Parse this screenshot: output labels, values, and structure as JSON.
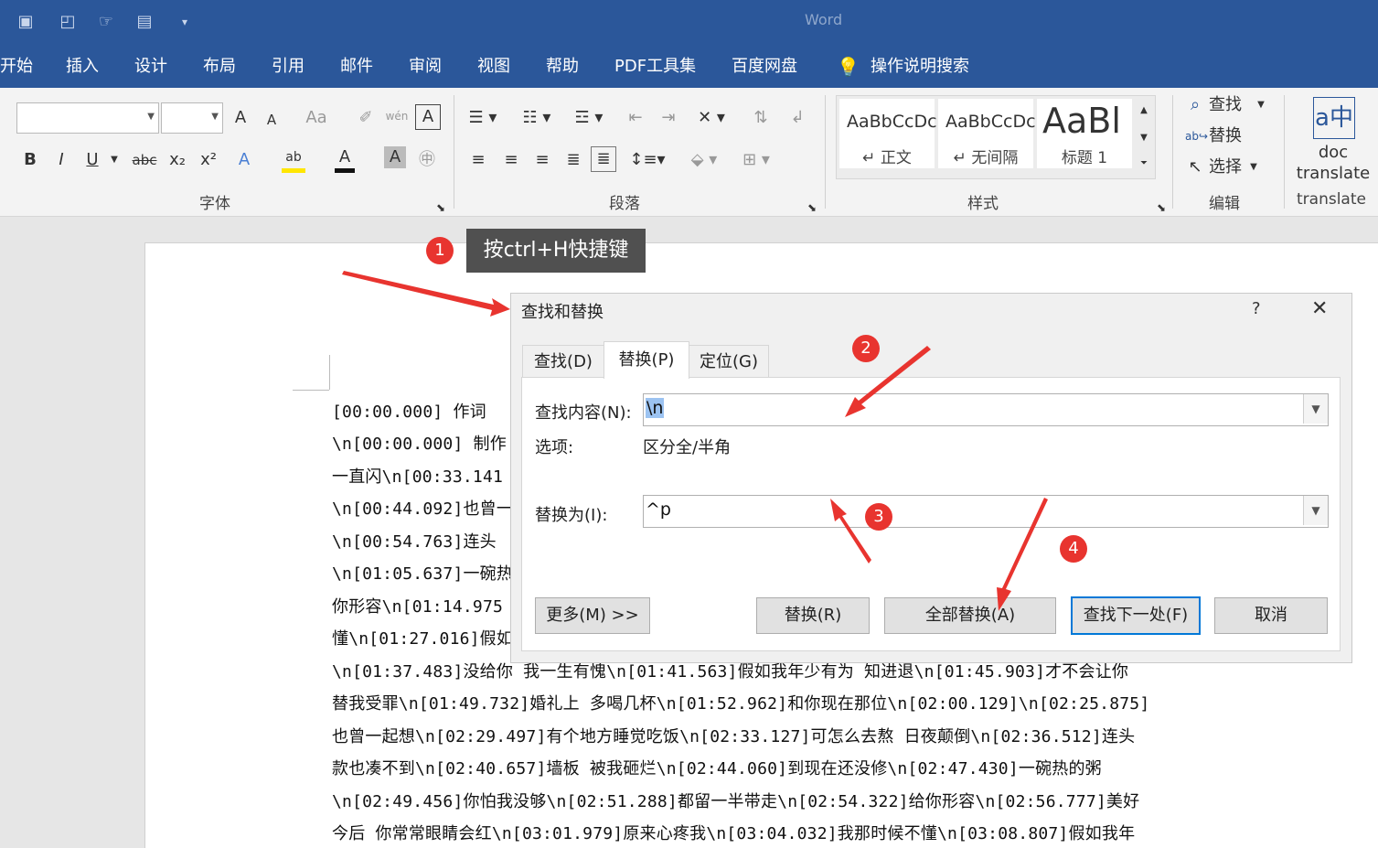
{
  "window": {
    "title": "Word"
  },
  "ribbon_tabs": [
    "开始",
    "插入",
    "设计",
    "布局",
    "引用",
    "邮件",
    "审阅",
    "视图",
    "帮助",
    "PDF工具集",
    "百度网盘",
    "操作说明搜索"
  ],
  "groups": {
    "font": "字体",
    "paragraph": "段落",
    "styles": "样式",
    "editing": "编辑",
    "translate": "translate"
  },
  "styles_gallery": [
    {
      "sample": "AaBbCcDc",
      "name": "↵ 正文"
    },
    {
      "sample": "AaBbCcDc",
      "name": "↵ 无间隔"
    },
    {
      "sample": "AaBl",
      "name": "标题 1"
    }
  ],
  "editing": {
    "find": "查找",
    "replace": "替换",
    "select": "选择"
  },
  "translate_button": {
    "line1": "doc",
    "line2": "translate"
  },
  "font_toolbar": {
    "bold": "B",
    "italic": "I",
    "underline": "U",
    "strike": "abc",
    "grow": "A",
    "shrink": "A",
    "case": "Aa",
    "phonetic": "wén",
    "font_color": "A",
    "highlight": "ab"
  },
  "callouts": {
    "step1": "1",
    "step2": "2",
    "step3": "3",
    "step4": "4",
    "tooltip": "按ctrl+H快捷键"
  },
  "dialog": {
    "title": "查找和替换",
    "help": "?",
    "close": "✕",
    "tabs": [
      "查找(D)",
      "替换(P)",
      "定位(G)"
    ],
    "find_label": "查找内容(N):",
    "find_value": "\\n",
    "options_label": "选项:",
    "options_value": "区分全/半角",
    "replace_label": "替换为(I):",
    "replace_value": "^p",
    "buttons": {
      "more": "更多(M) >>",
      "replace": "替换(R)",
      "replace_all": "全部替换(A)",
      "find_next": "查找下一处(F)",
      "cancel": "取消"
    }
  },
  "document_lines": [
    "[00:00.000] 作词",
    "\\n[00:00.000] 制作",
    "一直闪\\n[00:33.141",
    "\\n[00:44.092]也曾一",
    "\\n[00:54.763]连头",
    "\\n[01:05.637]一碗热",
    "你形容\\n[01:14.975",
    "懂\\n[01:27.016]假如",
    "\\n[01:37.483]没给你 我一生有愧\\n[01:41.563]假如我年少有为 知进退\\n[01:45.903]才不会让你",
    "替我受罪\\n[01:49.732]婚礼上 多喝几杯\\n[01:52.962]和你现在那位\\n[02:00.129]\\n[02:25.875]",
    "也曾一起想\\n[02:29.497]有个地方睡觉吃饭\\n[02:33.127]可怎么去熬 日夜颠倒\\n[02:36.512]连头",
    "款也凑不到\\n[02:40.657]墙板 被我砸烂\\n[02:44.060]到现在还没修\\n[02:47.430]一碗热的粥",
    "\\n[02:49.456]你怕我没够\\n[02:51.288]都留一半带走\\n[02:54.322]给你形容\\n[02:56.777]美好",
    "今后 你常常眼睛会红\\n[03:01.979]原来心疼我\\n[03:04.032]我那时候不懂\\n[03:08.807]假如我年"
  ]
}
